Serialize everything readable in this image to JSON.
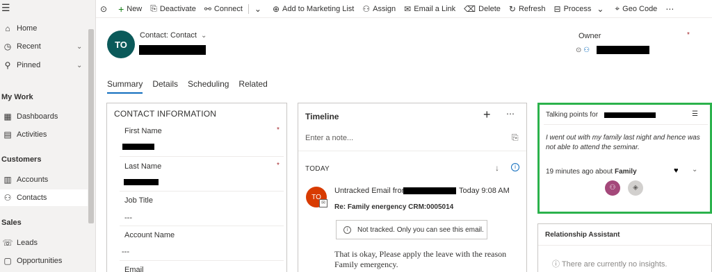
{
  "sidebar": {
    "items": [
      {
        "icon": "home-icon",
        "glyph": "⌂",
        "label": "Home"
      },
      {
        "icon": "clock-icon",
        "glyph": "◷",
        "label": "Recent"
      },
      {
        "icon": "pin-icon",
        "glyph": "⚲",
        "label": "Pinned"
      },
      {
        "icon": "dashboard-icon",
        "glyph": "▦",
        "label": "Dashboards"
      },
      {
        "icon": "activities-icon",
        "glyph": "▤",
        "label": "Activities"
      },
      {
        "icon": "accounts-icon",
        "glyph": "▥",
        "label": "Accounts"
      },
      {
        "icon": "contact-icon",
        "glyph": "⚇",
        "label": "Contacts"
      },
      {
        "icon": "phone-icon",
        "glyph": "☏",
        "label": "Leads"
      },
      {
        "icon": "opportunities-icon",
        "glyph": "▢",
        "label": "Opportunities"
      }
    ],
    "sections": {
      "my_work": "My Work",
      "customers": "Customers",
      "sales": "Sales"
    }
  },
  "commands": [
    {
      "icon": "plus-icon",
      "glyph": "+",
      "label": "New"
    },
    {
      "icon": "deactivate-icon",
      "glyph": "⎘",
      "label": "Deactivate"
    },
    {
      "icon": "connect-icon",
      "glyph": "⚯",
      "label": "Connect"
    },
    {
      "icon": "marketing-list-icon",
      "glyph": "⊕",
      "label": "Add to Marketing List"
    },
    {
      "icon": "assign-icon",
      "glyph": "⚇",
      "label": "Assign"
    },
    {
      "icon": "email-link-icon",
      "glyph": "✉",
      "label": "Email a Link"
    },
    {
      "icon": "delete-icon",
      "glyph": "🗑",
      "label": "Delete"
    },
    {
      "icon": "refresh-icon",
      "glyph": "↻",
      "label": "Refresh"
    },
    {
      "icon": "process-icon",
      "glyph": "⊟",
      "label": "Process"
    },
    {
      "icon": "geo-code-icon",
      "glyph": "⌖",
      "label": "Geo Code"
    }
  ],
  "header": {
    "avatar_initials": "TO",
    "entity_label": "Contact: Contact",
    "owner_label": "Owner"
  },
  "tabs": [
    "Summary",
    "Details",
    "Scheduling",
    "Related"
  ],
  "contact_info": {
    "title": "CONTACT INFORMATION",
    "fields": {
      "first_name": "First Name",
      "last_name": "Last Name",
      "job_title": "Job Title",
      "job_title_value": "---",
      "account_name": "Account Name",
      "account_name_value": "---",
      "email": "Email"
    }
  },
  "timeline": {
    "title": "Timeline",
    "note_placeholder": "Enter a note...",
    "today": "TODAY",
    "entry": {
      "avatar": "TO",
      "from_prefix": "Untracked Email from",
      "time": "Today 9:08 AM",
      "subject": "Re: Family energency CRM:0005014",
      "tracked_notice": "Not tracked. Only you can see this email.",
      "body": "That is okay, Please apply the leave with the reason Family emergency."
    }
  },
  "talking_points": {
    "title_prefix": "Talking points for",
    "text": "I went out with my family last night and hence was not able to attend the seminar.",
    "time_prefix": "19 minutes ago about",
    "topic": "Family"
  },
  "relationship_assistant": {
    "title": "Relationship Assistant",
    "empty": "There are currently no insights."
  },
  "colors": {
    "accent": "#0f6cbd",
    "highlight_border": "#2bb24c",
    "avatar_bg": "#0b5a5a",
    "timeline_avatar": "#d83b01"
  }
}
